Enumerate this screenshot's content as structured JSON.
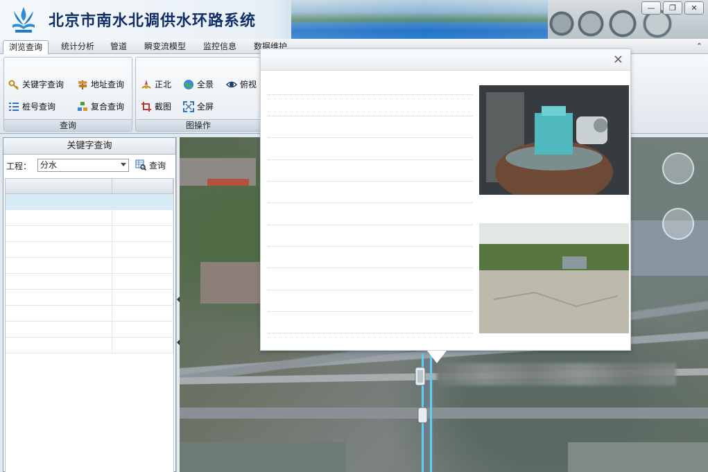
{
  "window": {
    "title": "北京市南水北调供水环路系统",
    "controls": {
      "minimize": "—",
      "restore": "❐",
      "close": "✕"
    }
  },
  "tabs": [
    {
      "label": "浏览查询",
      "active": true
    },
    {
      "label": "统计分析"
    },
    {
      "label": "管道"
    },
    {
      "label": "瞬变流模型"
    },
    {
      "label": "监控信息"
    },
    {
      "label": "数据维护"
    }
  ],
  "ribbon": {
    "collapse_icon": "⌃",
    "query_group": {
      "caption": "查询",
      "buttons": [
        {
          "label": "关键字查询",
          "icon": "key-icon"
        },
        {
          "label": "地址查询",
          "icon": "signpost-icon"
        },
        {
          "label": "桩号查询",
          "icon": "list-icon"
        },
        {
          "label": "复合查询",
          "icon": "stack-icon"
        }
      ]
    },
    "map_group": {
      "caption": "图操作",
      "buttons": [
        {
          "label": "正北",
          "icon": "compass-icon"
        },
        {
          "label": "全景",
          "icon": "globe-icon"
        },
        {
          "label": "俯视",
          "icon": "eye-icon"
        },
        {
          "label": "截图",
          "icon": "crop-icon"
        },
        {
          "label": "全屏",
          "icon": "fullscreen-icon"
        }
      ]
    }
  },
  "left_panel": {
    "title": "关键字查询",
    "project_label": "工程：",
    "project_value": "分水",
    "query_button": "查询",
    "table": {
      "headers": [
        "",
        ""
      ],
      "rows": [
        {
          "name": "",
          "stake": "",
          "selected": true
        },
        {
          "name": "",
          "stake": ""
        },
        {
          "name": "",
          "stake": ""
        },
        {
          "name": "",
          "stake": ""
        },
        {
          "name": "",
          "stake": ""
        },
        {
          "name": "",
          "stake": ""
        },
        {
          "name": "",
          "stake": ""
        },
        {
          "name": "",
          "stake": ""
        },
        {
          "name": "",
          "stake": ""
        },
        {
          "name": "",
          "stake": ""
        }
      ]
    }
  },
  "popup": {
    "title": "",
    "close_icon": "×",
    "fields": [
      {
        "label": "",
        "value": ""
      },
      {
        "label": "",
        "value": ""
      },
      {
        "label": "",
        "value": ""
      },
      {
        "label": "",
        "value": ""
      },
      {
        "label": "",
        "value": ""
      },
      {
        "label": "",
        "value": ""
      },
      {
        "label": "",
        "value": ""
      },
      {
        "label": "",
        "value": ""
      },
      {
        "label": "",
        "value": ""
      },
      {
        "label": "",
        "value": ""
      },
      {
        "label": "",
        "value": ""
      },
      {
        "label": "",
        "value": ""
      }
    ]
  },
  "colors": {
    "title_text": "#0f2d66",
    "pipe": "#5ed0f0",
    "selected_row": "#d7ecf7"
  }
}
